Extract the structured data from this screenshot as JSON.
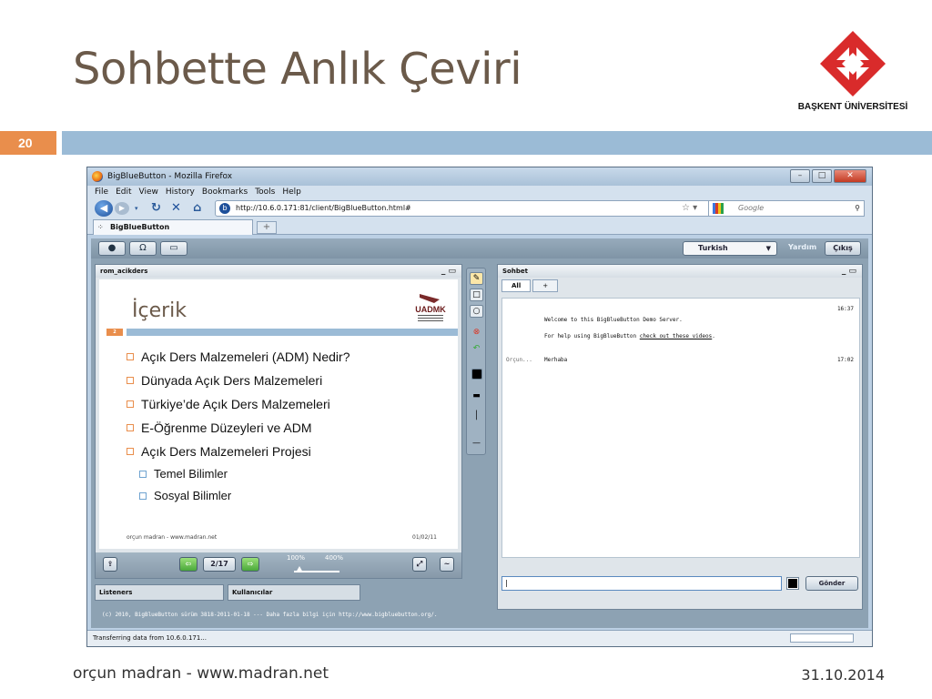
{
  "slide": {
    "title": "Sohbette Anlık Çeviri",
    "number": "20",
    "logo_text": "BAŞKENT ÜNİVERSİTESİ",
    "footer_left": "orçun madran - www.madran.net",
    "footer_right": "31.10.2014"
  },
  "browser": {
    "window_title": "BigBlueButton - Mozilla Firefox",
    "menu": [
      "File",
      "Edit",
      "View",
      "History",
      "Bookmarks",
      "Tools",
      "Help"
    ],
    "url": "http://10.6.0.171:81/client/BigBlueButton.html#",
    "search_placeholder": "Google",
    "tab_label": "BigBlueButton",
    "status_text": "Transferring data from 10.6.0.171..."
  },
  "bbb": {
    "language": "Turkish",
    "help_label": "Yardım",
    "exit_label": "Çıkış",
    "presentation": {
      "panel_title": "rom_acikders",
      "slide_title": "İçerik",
      "slide_num": "2",
      "items": [
        "Açık Ders Malzemeleri (ADM) Nedir?",
        "Dünyada Açık Ders Malzemeleri",
        "Türkiye’de Açık Ders Malzemeleri",
        "E-Öğrenme Düzeyleri ve ADM",
        "Açık Ders Malzemeleri Projesi"
      ],
      "subitems": [
        "Temel Bilimler",
        "Sosyal Bilimler"
      ],
      "slide_footer_left": "orçun madran - www.madran.net",
      "slide_footer_right": "01/02/11",
      "page_indicator": "2/17",
      "zoom_min": "100%",
      "zoom_max": "400%"
    },
    "listeners_label": "Listeners",
    "users_label": "Kullanıcılar",
    "chat": {
      "panel_title": "Sohbet",
      "tab_all": "All",
      "tab_plus": "+",
      "welcome": "Welcome to this BigBlueButton Demo Server.",
      "help_prefix": "For help using BigBlueButton ",
      "help_link": "check out these videos",
      "help_suffix": ".",
      "time1": "16:37",
      "sender": "Orçun...",
      "message": "Merhaba",
      "time2": "17:02",
      "send_label": "Gönder"
    },
    "copyright": "(c) 2010, BigBlueButton sürüm 3818-2011-01-18 --- Daha fazla bilgi için http://www.bigbluebutton.org/."
  }
}
